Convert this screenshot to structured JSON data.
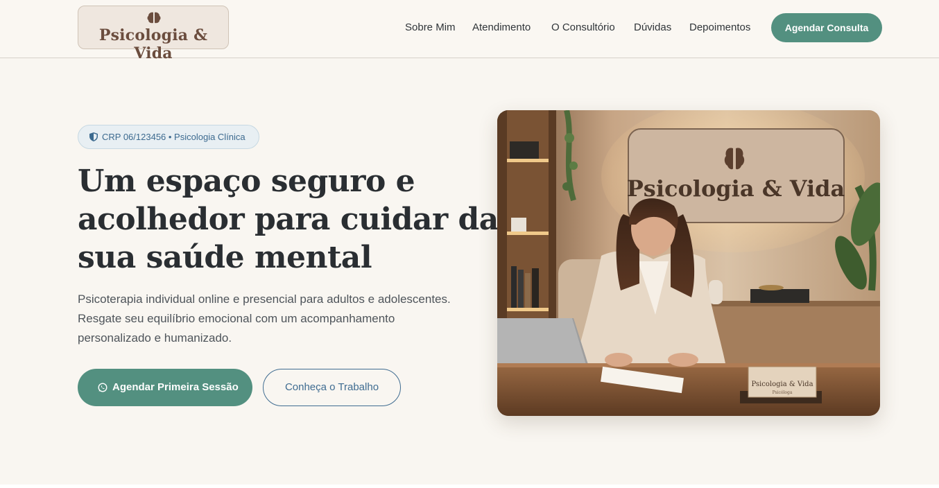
{
  "brand": {
    "name": "Psicologia & Vida",
    "icon": "brain-icon",
    "color": "#6b4d3e"
  },
  "nav": {
    "items": [
      "Sobre Mim",
      "Atendimento",
      "O Consultório",
      "Dúvidas",
      "Depoimentos"
    ],
    "cta_label": "Agendar Consulta"
  },
  "hero": {
    "badge": "CRP 06/123456 • Psicologia Clínica",
    "badge_icon": "shield-icon",
    "headline_lines": [
      "Um espaço seguro e",
      "acolhedor para cuidar da",
      "sua saúde mental"
    ],
    "subtext_lines": [
      "Psicoterapia individual online e presencial para adultos e adolescentes.",
      "Resgate seu equilíbrio emocional com um acompanhamento",
      "personalizado e humanizado."
    ],
    "primary_button": "Agendar Primeira Sessão",
    "primary_button_icon": "whatsapp-icon",
    "secondary_button": "Conheça o Trabalho"
  },
  "photo": {
    "sign_text": "Psicologia & Vida",
    "desk_card_title": "Psicologia & Vida",
    "desk_card_subtitle": "Psicóloga"
  },
  "colors": {
    "accent": "#539080",
    "link_blue": "#3f6c91",
    "background": "#f9f6f1"
  }
}
